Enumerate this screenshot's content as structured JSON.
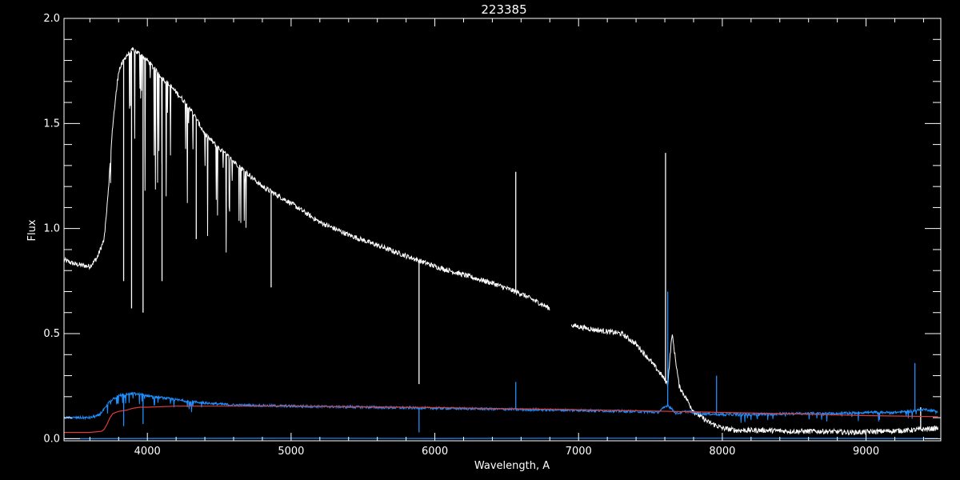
{
  "chart_data": {
    "type": "line",
    "title": "223385",
    "xlabel": "Wavelength, A",
    "ylabel": "Flux",
    "xlim": [
      3420,
      9520
    ],
    "ylim": [
      -0.01,
      2.0
    ],
    "x_ticks": [
      4000,
      5000,
      6000,
      7000,
      8000,
      9000
    ],
    "y_ticks": [
      0.0,
      0.5,
      1.0,
      1.5,
      2.0
    ],
    "x_tick_labels": [
      "4000",
      "5000",
      "6000",
      "7000",
      "8000",
      "9000"
    ],
    "y_tick_labels": [
      "0.0",
      "0.5",
      "1.0",
      "1.5",
      "2.0"
    ],
    "grid": false,
    "background": "#000000",
    "axis_color": "#ffffff",
    "series": [
      {
        "color": "#ffffff",
        "style": "noisy-spectrum",
        "x": [
          3420,
          3500,
          3600,
          3650,
          3700,
          3730,
          3760,
          3800,
          3850,
          3900,
          3950,
          4000,
          4100,
          4200,
          4300,
          4400,
          4500,
          4600,
          4800,
          5000,
          5200,
          5400,
          5600,
          5800,
          6000,
          6200,
          6400,
          6600,
          6800,
          null,
          6950,
          7100,
          7200,
          7300,
          7400,
          7500,
          7580,
          7620,
          7650,
          7700,
          7800,
          7900,
          8000,
          8100,
          8300,
          8500,
          8700,
          8900,
          9100,
          9300,
          9400,
          9500
        ],
        "y": [
          0.85,
          0.83,
          0.82,
          0.86,
          0.95,
          1.2,
          1.5,
          1.75,
          1.82,
          1.85,
          1.83,
          1.8,
          1.72,
          1.65,
          1.57,
          1.45,
          1.38,
          1.32,
          1.2,
          1.12,
          1.03,
          0.97,
          0.92,
          0.87,
          0.82,
          0.78,
          0.74,
          0.69,
          0.62,
          null,
          0.54,
          0.52,
          0.51,
          0.5,
          0.45,
          0.37,
          0.3,
          0.26,
          0.5,
          0.25,
          0.13,
          0.08,
          0.05,
          0.04,
          0.04,
          0.035,
          0.035,
          0.03,
          0.035,
          0.04,
          0.045,
          0.05
        ],
        "spikes": [
          [
            3835,
            0.75
          ],
          [
            3890,
            0.62
          ],
          [
            3970,
            0.6
          ],
          [
            4102,
            0.75
          ],
          [
            4340,
            0.95
          ],
          [
            4861,
            0.72
          ],
          [
            5890,
            0.26
          ],
          [
            6563,
            1.27
          ],
          [
            7605,
            1.36
          ],
          [
            9380,
            0.15
          ]
        ]
      },
      {
        "color": "#1e90ff",
        "style": "noisy-spectrum",
        "x": [
          3420,
          3500,
          3600,
          3660,
          3700,
          3730,
          3760,
          3800,
          3850,
          3900,
          3950,
          4000,
          4100,
          4200,
          4400,
          4600,
          5000,
          5500,
          6000,
          6500,
          7000,
          7400,
          7550,
          7620,
          7680,
          7750,
          7850,
          8000,
          8200,
          8500,
          8800,
          9000,
          9200,
          9300,
          9400,
          9500
        ],
        "y": [
          0.1,
          0.1,
          0.1,
          0.11,
          0.14,
          0.17,
          0.19,
          0.205,
          0.21,
          0.215,
          0.21,
          0.205,
          0.195,
          0.185,
          0.17,
          0.16,
          0.155,
          0.15,
          0.145,
          0.14,
          0.135,
          0.13,
          0.125,
          0.16,
          0.12,
          0.13,
          0.12,
          0.115,
          0.115,
          0.12,
          0.12,
          0.125,
          0.125,
          0.13,
          0.14,
          0.13
        ],
        "spikes": [
          [
            3835,
            0.06
          ],
          [
            3970,
            0.07
          ],
          [
            5890,
            0.03
          ],
          [
            6563,
            0.27
          ],
          [
            7620,
            0.7
          ],
          [
            7960,
            0.3
          ],
          [
            9340,
            0.36
          ]
        ]
      },
      {
        "color": "#e23b3b",
        "style": "smooth",
        "x": [
          3420,
          3500,
          3600,
          3680,
          3700,
          3720,
          3740,
          3760,
          3800,
          3850,
          3900,
          3950,
          4000,
          4200,
          4400,
          5000,
          5500,
          6000,
          6500,
          7000,
          7500,
          8000,
          8500,
          9000,
          9500
        ],
        "y": [
          0.03,
          0.03,
          0.03,
          0.035,
          0.045,
          0.07,
          0.1,
          0.12,
          0.13,
          0.135,
          0.145,
          0.15,
          0.15,
          0.155,
          0.155,
          0.155,
          0.152,
          0.148,
          0.143,
          0.138,
          0.132,
          0.125,
          0.118,
          0.11,
          0.105
        ]
      },
      {
        "color": "#1e90ff",
        "style": "smooth",
        "x": [
          3420,
          4000,
          5000,
          6000,
          7000,
          8000,
          9000,
          9500
        ],
        "y": [
          0.0,
          0.001,
          0.002,
          0.001,
          0.002,
          0.002,
          0.001,
          0.001
        ]
      }
    ]
  }
}
